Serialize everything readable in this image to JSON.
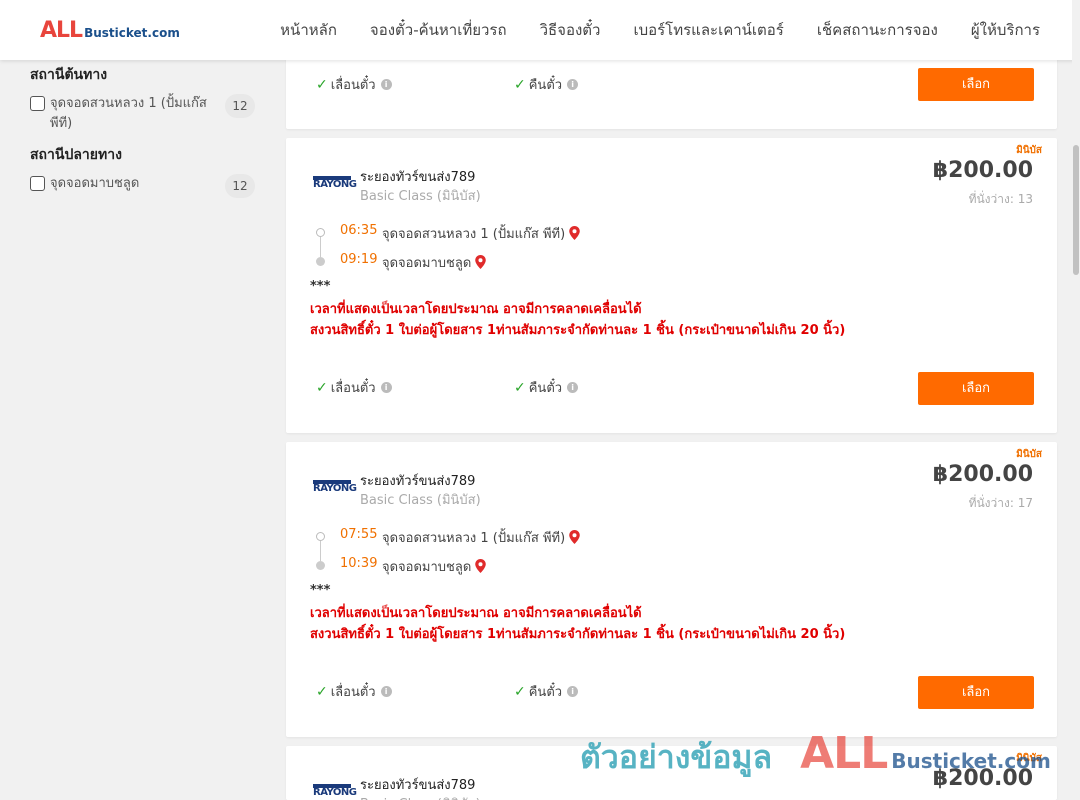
{
  "header": {
    "logo_all": "ALL",
    "logo_rest": "Busticket.com",
    "nav": [
      "หน้าหลัก",
      "จองตั๋ว-ค้นหาเที่ยวรถ",
      "วิธีจองตั๋ว",
      "เบอร์โทรและเคาน์เตอร์",
      "เช็คสถานะการจอง",
      "ผู้ให้บริการ"
    ]
  },
  "sidebar": {
    "origin_title": "สถานีต้นทาง",
    "origin_items": [
      {
        "label": "จุดจอดสวนหลวง 1 (ปั้มแก๊ส พีที)",
        "count": "12"
      }
    ],
    "dest_title": "สถานีปลายทาง",
    "dest_items": [
      {
        "label": "จุดจอดมาบชลูด",
        "count": "12"
      }
    ]
  },
  "common": {
    "feature_reschedule": "เลื่อนตั๋ว",
    "feature_refund": "คืนตั๋ว",
    "select_label": "เลือก",
    "badge": "มินิบัส",
    "stars": "***",
    "notice_line1": "เวลาที่แสดงเป็นเวลาโดยประมาณ อาจมีการคลาดเคลื่อนได้",
    "notice_line2": "สงวนสิทธิ์ตั๋ว 1 ใบต่อผู้โดยสาร 1ท่านสัมภาระจำกัดท่านละ 1 ชิ้น (กระเป๋าขนาดไม่เกิน 20 นิ้ว)",
    "logo_text": "RAYONG"
  },
  "trips": [
    {
      "operator": "ระยองทัวร์ขนส่ง789",
      "class": "Basic Class (มินิบัส)",
      "price": "฿200.00",
      "seats": "ที่นั่งว่าง: 13",
      "depart_time": "06:35",
      "depart_place": "จุดจอดสวนหลวง 1 (ปั้มแก๊ส พีที)",
      "arrive_time": "09:19",
      "arrive_place": "จุดจอดมาบชลูด"
    },
    {
      "operator": "ระยองทัวร์ขนส่ง789",
      "class": "Basic Class (มินิบัส)",
      "price": "฿200.00",
      "seats": "ที่นั่งว่าง: 17",
      "depart_time": "07:55",
      "depart_place": "จุดจอดสวนหลวง 1 (ปั้มแก๊ส พีที)",
      "arrive_time": "10:39",
      "arrive_place": "จุดจอดมาบชลูด"
    },
    {
      "operator": "ระยองทัวร์ขนส่ง789",
      "class": "Basic Class (มินิบัส)",
      "price": "฿200.00"
    }
  ],
  "watermark": {
    "thai": "ตัวอย่างข้อมูล",
    "all": "ALL",
    "rest": "Busticket.com"
  }
}
